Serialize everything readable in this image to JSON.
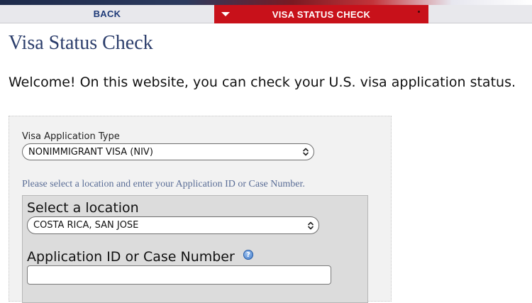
{
  "nav": {
    "back_label": "BACK",
    "active_label": "VISA STATUS CHECK"
  },
  "page": {
    "title": "Visa Status Check",
    "welcome": "Welcome! On this website, you can check your U.S. visa application status."
  },
  "form": {
    "visa_type_label": "Visa Application Type",
    "visa_type_value": "NONIMMIGRANT VISA (NIV)",
    "instruction": "Please select a location and enter your Application ID or Case Number.",
    "location_label": "Select a location",
    "location_value": "COSTA RICA, SAN JOSE",
    "appid_label": "Application ID or Case Number",
    "appid_value": "",
    "help_icon": "help-question-icon"
  },
  "colors": {
    "accent_red": "#c8111a",
    "title_blue": "#2b3d6b",
    "nav_text_blue": "#1e3a78"
  }
}
